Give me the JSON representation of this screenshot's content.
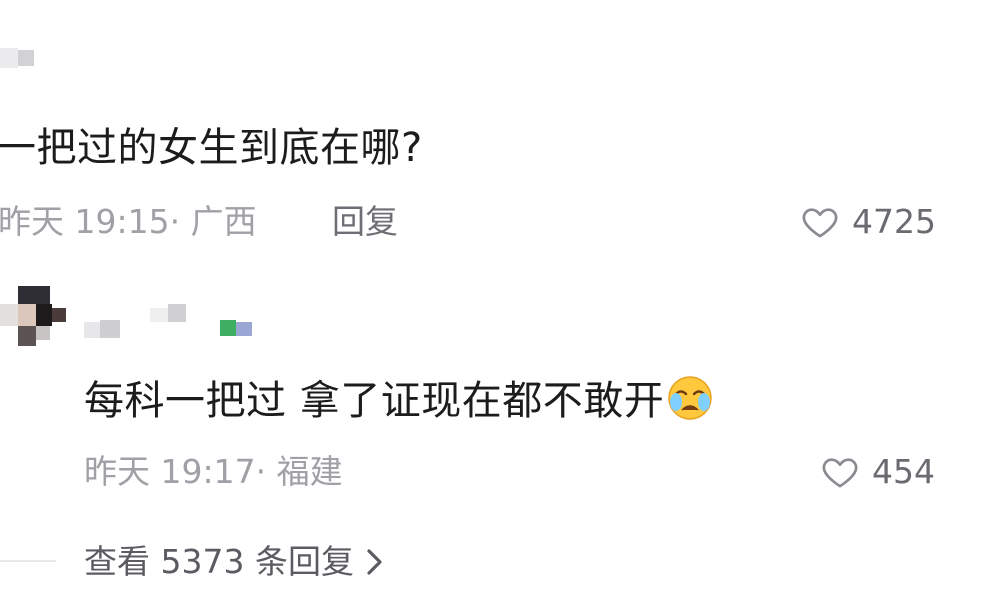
{
  "comments": [
    {
      "text": "一把过的女生到底在哪?",
      "time": "昨天 19:15",
      "location": "· 广西",
      "reply_label": "回复",
      "likes": "4725"
    },
    {
      "text": "每科一把过 拿了证现在都不敢开",
      "emoji": "crying-face-emoji",
      "time": "昨天 19:17",
      "location": "· 福建",
      "likes": "454"
    }
  ],
  "view_replies": {
    "label": "查看 5373 条回复",
    "chevron": "chevron-right-icon"
  },
  "colors": {
    "text": "#1c1c1e",
    "meta": "#a0a0a6",
    "like": "#6a6a70"
  }
}
